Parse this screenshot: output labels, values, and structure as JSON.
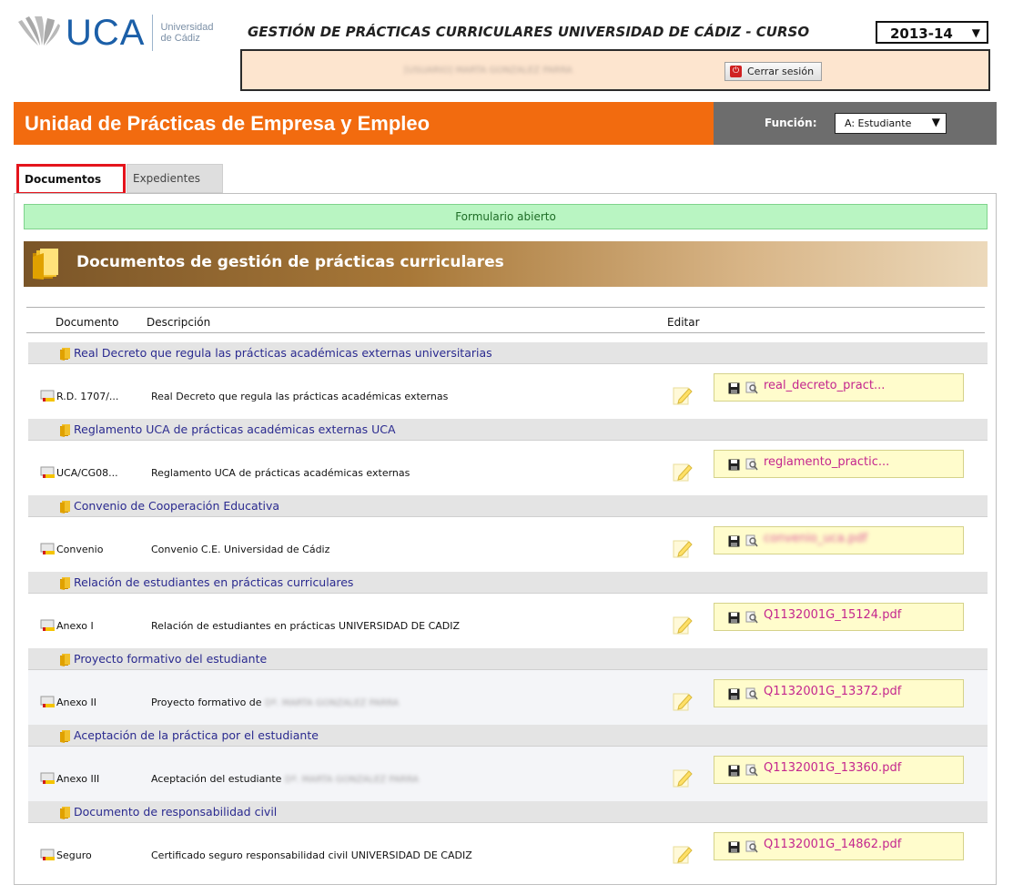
{
  "header": {
    "logo_text": "UCA",
    "logo_sub_line1": "Universidad",
    "logo_sub_line2": "de Cádiz",
    "app_title": "GESTIÓN DE PRÁCTICAS CURRICULARES UNIVERSIDAD DE CÁDIZ - CURSO",
    "course_year": "2013-14",
    "user_name": "[USUARIO] MARTA GONZÁLEZ PARRA",
    "logout_label": "Cerrar sesión"
  },
  "band": {
    "title": "Unidad de Prácticas de Empresa y Empleo",
    "function_label": "Función:",
    "function_value": "A: Estudiante"
  },
  "tabs": [
    {
      "label": "Documentos",
      "active": true
    },
    {
      "label": "Expedientes",
      "active": false
    }
  ],
  "status_message": "Formulario abierto",
  "section_title": "Documentos de gestión de prácticas curriculares",
  "columns": {
    "document": "Documento",
    "description": "Descripción",
    "edit": "Editar"
  },
  "groups": [
    {
      "title": "Real Decreto que regula las prácticas académicas externas universitarias",
      "row": {
        "code": "R.D. 1707/...",
        "description": "Real Decreto que regula las prácticas académicas externas",
        "file": "real_decreto_pract...",
        "file_blurred": false
      }
    },
    {
      "title": "Reglamento UCA de prácticas académicas externas UCA",
      "row": {
        "code": "UCA/CG08...",
        "description": "Reglamento UCA de prácticas académicas externas",
        "file": "reglamento_practic...",
        "file_blurred": false
      }
    },
    {
      "title": "Convenio de Cooperación Educativa",
      "row": {
        "code": "Convenio",
        "description": "Convenio C.E. Universidad de Cádiz",
        "file": "convenio_uca.pdf",
        "file_blurred": true
      }
    },
    {
      "title": "Relación de estudiantes en prácticas curriculares",
      "row": {
        "code": "Anexo I",
        "description": "Relación de estudiantes en prácticas UNIVERSIDAD DE CADIZ",
        "file": "Q1132001G_15124.pdf",
        "file_blurred": false
      }
    },
    {
      "title": "Proyecto formativo del estudiante",
      "row": {
        "code": "Anexo II",
        "description": "Proyecto formativo de",
        "description_blurred": "Dª. MARTA GONZÁLEZ PARRA",
        "file": "Q1132001G_13372.pdf",
        "file_blurred": false
      }
    },
    {
      "title": "Aceptación de la práctica por el estudiante",
      "row": {
        "code": "Anexo III",
        "description": "Aceptación del estudiante",
        "description_blurred": "Dª. MARTA GONZÁLEZ PARRA",
        "file": "Q1132001G_13360.pdf",
        "file_blurred": false
      }
    },
    {
      "title": "Documento de responsabilidad civil",
      "row": {
        "code": "Seguro",
        "description": "Certificado seguro responsabilidad civil UNIVERSIDAD DE CADIZ",
        "file": "Q1132001G_14862.pdf",
        "file_blurred": false
      }
    }
  ],
  "colors": {
    "accent_orange": "#f26b0f",
    "band_gray": "#6d6d6d",
    "status_green": "#b9f5c2",
    "group_title_blue": "#2a2a8f",
    "file_link_magenta": "#c4268e",
    "file_box_yellow": "#fffccc",
    "active_tab_outline": "#e4141c"
  },
  "icons": {
    "logo": "uca-logo-icon",
    "logout": "power-icon",
    "section": "folder-icon",
    "group": "folder-icon",
    "document": "document-icon",
    "edit": "pencil-icon",
    "save": "save-icon",
    "view": "magnifier-icon"
  }
}
